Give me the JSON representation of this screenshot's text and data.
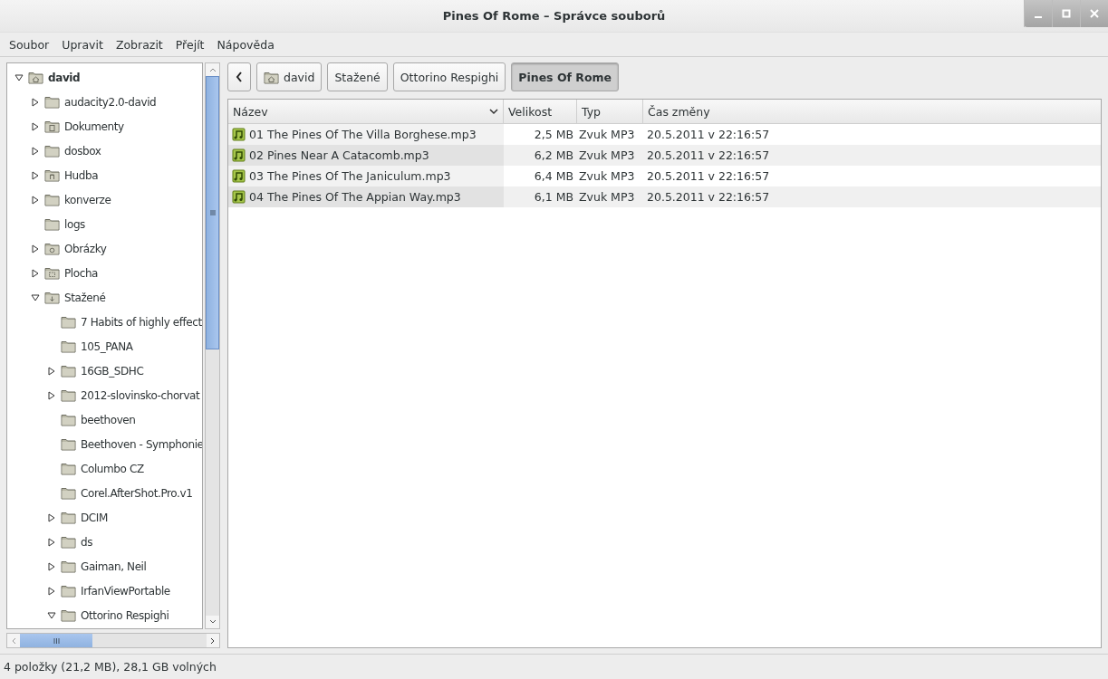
{
  "window": {
    "title": "Pines Of Rome – Správce souborů"
  },
  "menu": [
    "Soubor",
    "Upravit",
    "Zobrazit",
    "Přejít",
    "Nápověda"
  ],
  "tree": [
    {
      "label": "david",
      "kind": "home",
      "expandable": true,
      "expanded": true,
      "children": [
        {
          "label": "audacity2.0-david",
          "kind": "folder",
          "expandable": true,
          "expanded": false
        },
        {
          "label": "Dokumenty",
          "kind": "documents",
          "expandable": true,
          "expanded": false
        },
        {
          "label": "dosbox",
          "kind": "folder",
          "expandable": true,
          "expanded": false
        },
        {
          "label": "Hudba",
          "kind": "music",
          "expandable": true,
          "expanded": false
        },
        {
          "label": "konverze",
          "kind": "folder",
          "expandable": true,
          "expanded": false
        },
        {
          "label": "logs",
          "kind": "folder",
          "expandable": false
        },
        {
          "label": "Obrázky",
          "kind": "pictures",
          "expandable": true,
          "expanded": false
        },
        {
          "label": "Plocha",
          "kind": "desktop",
          "expandable": true,
          "expanded": false
        },
        {
          "label": "Stažené",
          "kind": "downloads",
          "expandable": true,
          "expanded": true,
          "children": [
            {
              "label": "7 Habits of highly effect",
              "kind": "folder",
              "expandable": false
            },
            {
              "label": "105_PANA",
              "kind": "folder",
              "expandable": false
            },
            {
              "label": "16GB_SDHC",
              "kind": "folder",
              "expandable": true,
              "expanded": false
            },
            {
              "label": "2012-slovinsko-chorvat",
              "kind": "folder",
              "expandable": true,
              "expanded": false
            },
            {
              "label": "beethoven",
              "kind": "folder",
              "expandable": false
            },
            {
              "label": "Beethoven - Symphonie",
              "kind": "folder",
              "expandable": false
            },
            {
              "label": "Columbo CZ",
              "kind": "folder",
              "expandable": false
            },
            {
              "label": "Corel.AfterShot.Pro.v1",
              "kind": "folder",
              "expandable": false
            },
            {
              "label": "DCIM",
              "kind": "folder",
              "expandable": true,
              "expanded": false
            },
            {
              "label": "ds",
              "kind": "folder",
              "expandable": true,
              "expanded": false
            },
            {
              "label": "Gaiman, Neil",
              "kind": "folder",
              "expandable": true,
              "expanded": false
            },
            {
              "label": "IrfanViewPortable",
              "kind": "folder",
              "expandable": true,
              "expanded": false
            },
            {
              "label": "Ottorino Respighi",
              "kind": "folder",
              "expandable": true,
              "expanded": true
            }
          ]
        }
      ]
    }
  ],
  "breadcrumbs": [
    {
      "label": "david",
      "kind": "home",
      "selected": false
    },
    {
      "label": "Stažené",
      "kind": "folder",
      "selected": false
    },
    {
      "label": "Ottorino Respighi",
      "kind": "folder",
      "selected": false
    },
    {
      "label": "Pines Of Rome",
      "kind": "folder",
      "selected": true
    }
  ],
  "table": {
    "columns": [
      "Název",
      "Velikost",
      "Typ",
      "Čas změny"
    ],
    "rows": [
      [
        "01 The Pines Of The Villa Borghese.mp3",
        "2,5 MB",
        "Zvuk MP3",
        "20.5.2011 v 22:16:57"
      ],
      [
        "02 Pines Near A Catacomb.mp3",
        "6,2 MB",
        "Zvuk MP3",
        "20.5.2011 v 22:16:57"
      ],
      [
        "03 The Pines Of The Janiculum.mp3",
        "6,4 MB",
        "Zvuk MP3",
        "20.5.2011 v 22:16:57"
      ],
      [
        "04 The Pines Of The Appian Way.mp3",
        "6,1 MB",
        "Zvuk MP3",
        "20.5.2011 v 22:16:57"
      ]
    ]
  },
  "status_bar": "4 položky (21,2 MB), 28,1 GB volných"
}
